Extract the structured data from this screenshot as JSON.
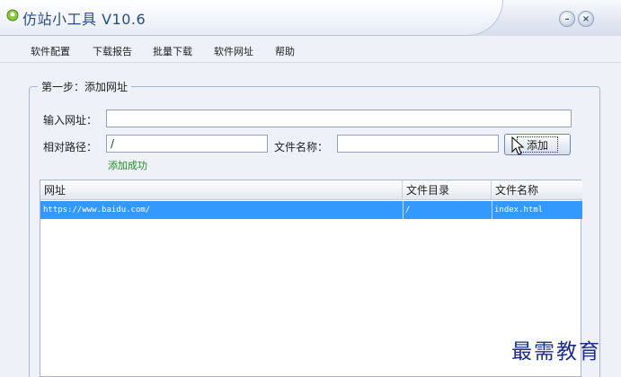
{
  "window": {
    "title": "仿站小工具 V10.6",
    "icon": "app-leaf-icon",
    "controls": {
      "minimize": "–",
      "close": "×"
    }
  },
  "menu": {
    "items": [
      "软件配置",
      "下载报告",
      "批量下载",
      "软件网址",
      "帮助"
    ]
  },
  "step": {
    "title": "第一步：添加网址",
    "url_label": "输入网址：",
    "url_value": "",
    "path_label": "相对路径：",
    "path_value": "/",
    "filename_label": "文件名称：",
    "filename_value": "",
    "add_button": "添加",
    "status_text": "添加成功"
  },
  "table": {
    "columns": [
      "网址",
      "文件目录",
      "文件名称"
    ],
    "rows": [
      {
        "url": "https://www.baidu.com/",
        "dir": "/",
        "file": "index.html",
        "selected": true
      }
    ]
  },
  "watermark": "最需教育",
  "colors": {
    "accent": "#2a4c86",
    "selection": "#3399ff",
    "success": "#1e8a1e",
    "watermark": "#1d2f8a"
  }
}
